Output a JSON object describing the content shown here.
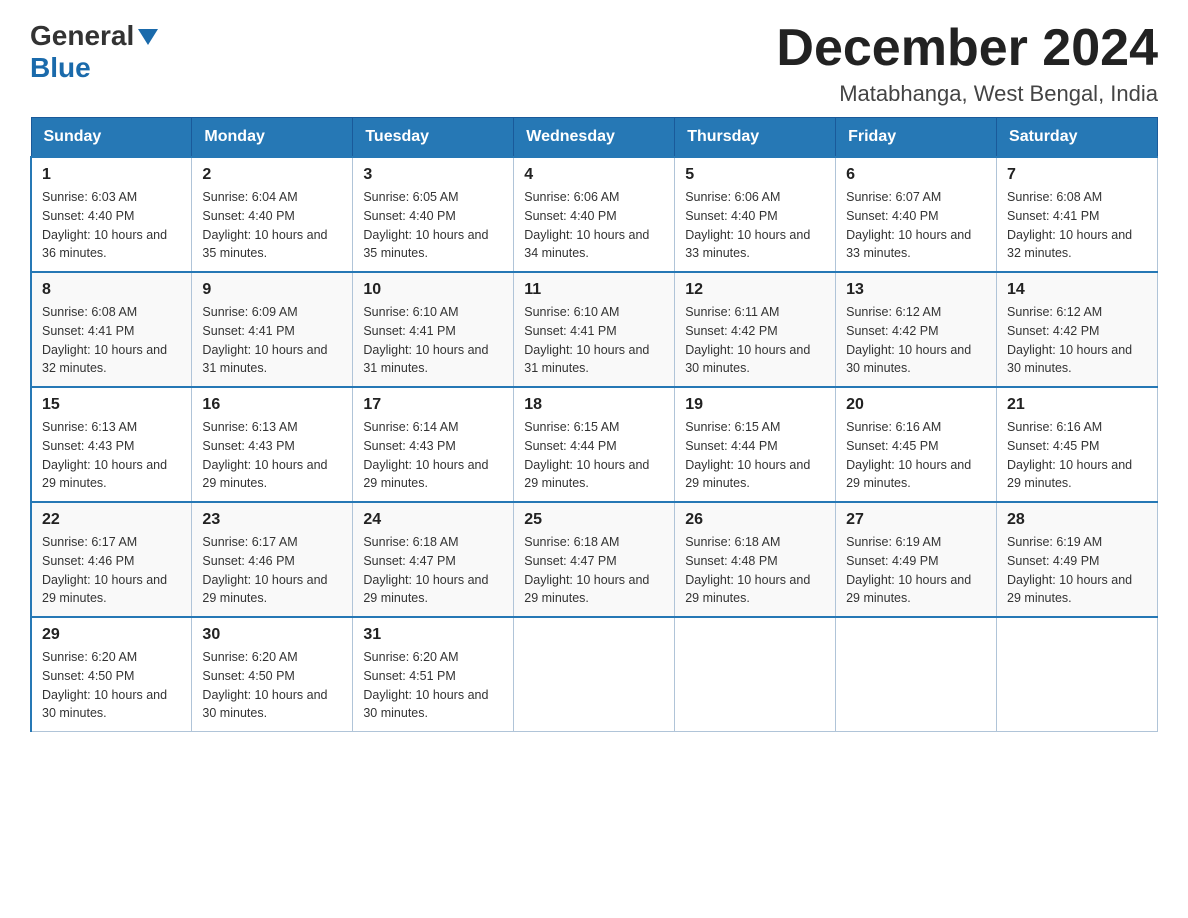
{
  "header": {
    "logo_general": "General",
    "logo_blue": "Blue",
    "title": "December 2024",
    "subtitle": "Matabhanga, West Bengal, India"
  },
  "columns": [
    "Sunday",
    "Monday",
    "Tuesday",
    "Wednesday",
    "Thursday",
    "Friday",
    "Saturday"
  ],
  "weeks": [
    [
      {
        "day": "1",
        "sunrise": "Sunrise: 6:03 AM",
        "sunset": "Sunset: 4:40 PM",
        "daylight": "Daylight: 10 hours and 36 minutes."
      },
      {
        "day": "2",
        "sunrise": "Sunrise: 6:04 AM",
        "sunset": "Sunset: 4:40 PM",
        "daylight": "Daylight: 10 hours and 35 minutes."
      },
      {
        "day": "3",
        "sunrise": "Sunrise: 6:05 AM",
        "sunset": "Sunset: 4:40 PM",
        "daylight": "Daylight: 10 hours and 35 minutes."
      },
      {
        "day": "4",
        "sunrise": "Sunrise: 6:06 AM",
        "sunset": "Sunset: 4:40 PM",
        "daylight": "Daylight: 10 hours and 34 minutes."
      },
      {
        "day": "5",
        "sunrise": "Sunrise: 6:06 AM",
        "sunset": "Sunset: 4:40 PM",
        "daylight": "Daylight: 10 hours and 33 minutes."
      },
      {
        "day": "6",
        "sunrise": "Sunrise: 6:07 AM",
        "sunset": "Sunset: 4:40 PM",
        "daylight": "Daylight: 10 hours and 33 minutes."
      },
      {
        "day": "7",
        "sunrise": "Sunrise: 6:08 AM",
        "sunset": "Sunset: 4:41 PM",
        "daylight": "Daylight: 10 hours and 32 minutes."
      }
    ],
    [
      {
        "day": "8",
        "sunrise": "Sunrise: 6:08 AM",
        "sunset": "Sunset: 4:41 PM",
        "daylight": "Daylight: 10 hours and 32 minutes."
      },
      {
        "day": "9",
        "sunrise": "Sunrise: 6:09 AM",
        "sunset": "Sunset: 4:41 PM",
        "daylight": "Daylight: 10 hours and 31 minutes."
      },
      {
        "day": "10",
        "sunrise": "Sunrise: 6:10 AM",
        "sunset": "Sunset: 4:41 PM",
        "daylight": "Daylight: 10 hours and 31 minutes."
      },
      {
        "day": "11",
        "sunrise": "Sunrise: 6:10 AM",
        "sunset": "Sunset: 4:41 PM",
        "daylight": "Daylight: 10 hours and 31 minutes."
      },
      {
        "day": "12",
        "sunrise": "Sunrise: 6:11 AM",
        "sunset": "Sunset: 4:42 PM",
        "daylight": "Daylight: 10 hours and 30 minutes."
      },
      {
        "day": "13",
        "sunrise": "Sunrise: 6:12 AM",
        "sunset": "Sunset: 4:42 PM",
        "daylight": "Daylight: 10 hours and 30 minutes."
      },
      {
        "day": "14",
        "sunrise": "Sunrise: 6:12 AM",
        "sunset": "Sunset: 4:42 PM",
        "daylight": "Daylight: 10 hours and 30 minutes."
      }
    ],
    [
      {
        "day": "15",
        "sunrise": "Sunrise: 6:13 AM",
        "sunset": "Sunset: 4:43 PM",
        "daylight": "Daylight: 10 hours and 29 minutes."
      },
      {
        "day": "16",
        "sunrise": "Sunrise: 6:13 AM",
        "sunset": "Sunset: 4:43 PM",
        "daylight": "Daylight: 10 hours and 29 minutes."
      },
      {
        "day": "17",
        "sunrise": "Sunrise: 6:14 AM",
        "sunset": "Sunset: 4:43 PM",
        "daylight": "Daylight: 10 hours and 29 minutes."
      },
      {
        "day": "18",
        "sunrise": "Sunrise: 6:15 AM",
        "sunset": "Sunset: 4:44 PM",
        "daylight": "Daylight: 10 hours and 29 minutes."
      },
      {
        "day": "19",
        "sunrise": "Sunrise: 6:15 AM",
        "sunset": "Sunset: 4:44 PM",
        "daylight": "Daylight: 10 hours and 29 minutes."
      },
      {
        "day": "20",
        "sunrise": "Sunrise: 6:16 AM",
        "sunset": "Sunset: 4:45 PM",
        "daylight": "Daylight: 10 hours and 29 minutes."
      },
      {
        "day": "21",
        "sunrise": "Sunrise: 6:16 AM",
        "sunset": "Sunset: 4:45 PM",
        "daylight": "Daylight: 10 hours and 29 minutes."
      }
    ],
    [
      {
        "day": "22",
        "sunrise": "Sunrise: 6:17 AM",
        "sunset": "Sunset: 4:46 PM",
        "daylight": "Daylight: 10 hours and 29 minutes."
      },
      {
        "day": "23",
        "sunrise": "Sunrise: 6:17 AM",
        "sunset": "Sunset: 4:46 PM",
        "daylight": "Daylight: 10 hours and 29 minutes."
      },
      {
        "day": "24",
        "sunrise": "Sunrise: 6:18 AM",
        "sunset": "Sunset: 4:47 PM",
        "daylight": "Daylight: 10 hours and 29 minutes."
      },
      {
        "day": "25",
        "sunrise": "Sunrise: 6:18 AM",
        "sunset": "Sunset: 4:47 PM",
        "daylight": "Daylight: 10 hours and 29 minutes."
      },
      {
        "day": "26",
        "sunrise": "Sunrise: 6:18 AM",
        "sunset": "Sunset: 4:48 PM",
        "daylight": "Daylight: 10 hours and 29 minutes."
      },
      {
        "day": "27",
        "sunrise": "Sunrise: 6:19 AM",
        "sunset": "Sunset: 4:49 PM",
        "daylight": "Daylight: 10 hours and 29 minutes."
      },
      {
        "day": "28",
        "sunrise": "Sunrise: 6:19 AM",
        "sunset": "Sunset: 4:49 PM",
        "daylight": "Daylight: 10 hours and 29 minutes."
      }
    ],
    [
      {
        "day": "29",
        "sunrise": "Sunrise: 6:20 AM",
        "sunset": "Sunset: 4:50 PM",
        "daylight": "Daylight: 10 hours and 30 minutes."
      },
      {
        "day": "30",
        "sunrise": "Sunrise: 6:20 AM",
        "sunset": "Sunset: 4:50 PM",
        "daylight": "Daylight: 10 hours and 30 minutes."
      },
      {
        "day": "31",
        "sunrise": "Sunrise: 6:20 AM",
        "sunset": "Sunset: 4:51 PM",
        "daylight": "Daylight: 10 hours and 30 minutes."
      },
      null,
      null,
      null,
      null
    ]
  ]
}
